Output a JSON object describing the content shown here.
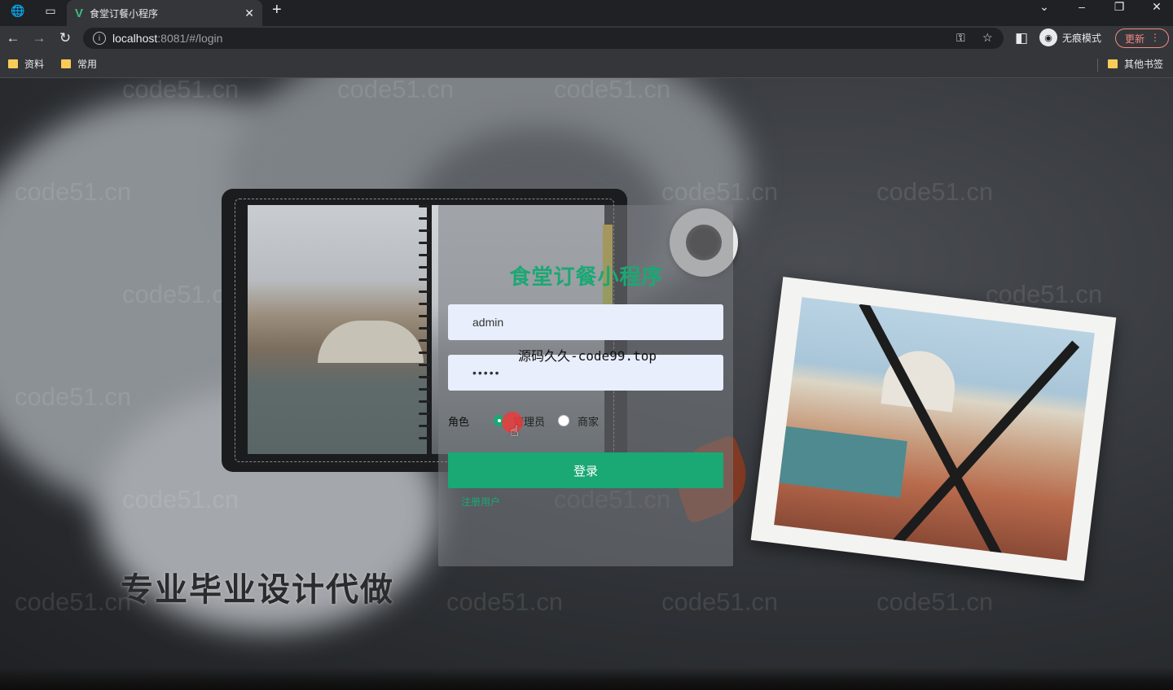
{
  "browser": {
    "tab_title": "食堂订餐小程序",
    "url_host": "localhost",
    "url_rest": ":8081/#/login",
    "profile_label": "无痕模式",
    "update_label": "更新",
    "bookmarks": [
      "资料",
      "常用"
    ],
    "other_bookmarks": "其他书签"
  },
  "login": {
    "title": "食堂订餐小程序",
    "username_value": "admin",
    "password_value": "•••••",
    "role_label": "角色",
    "roles": [
      "管理员",
      "商家"
    ],
    "selected_role": "管理员",
    "submit_label": "登录",
    "register_label": "注册用户"
  },
  "overlay": {
    "source_watermark": "源码久久-code99.top",
    "promo_text": "专业毕业设计代做",
    "watermark_text": "code51.cn"
  },
  "colors": {
    "accent": "#1aa874",
    "chrome_bg": "#202124",
    "toolbar_bg": "#35363a"
  }
}
